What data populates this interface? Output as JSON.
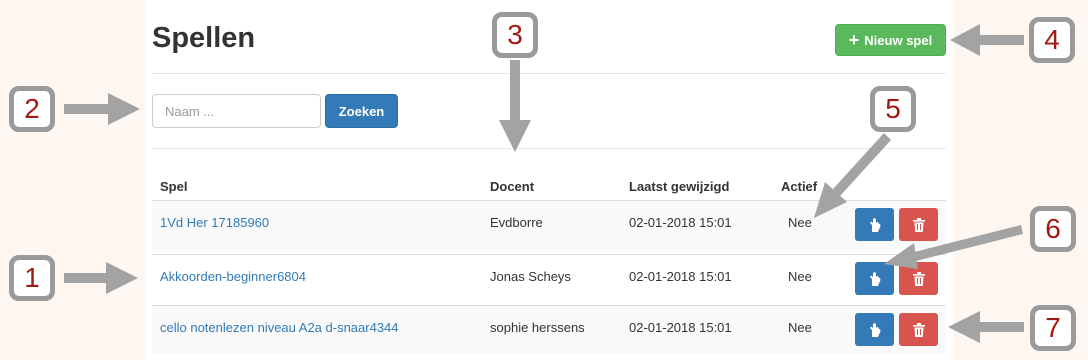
{
  "page": {
    "title": "Spellen"
  },
  "toolbar": {
    "new_game_label": "Nieuw spel",
    "plus_icon": "plus-icon"
  },
  "search": {
    "placeholder": "Naam ...",
    "button_label": "Zoeken"
  },
  "table": {
    "headers": {
      "game": "Spel",
      "teacher": "Docent",
      "modified": "Laatst gewijzigd",
      "active": "Actief"
    },
    "rows": [
      {
        "game": "1Vd Her 17185960",
        "teacher": "Evdborre",
        "modified": "02-01-2018 15:01",
        "active": "Nee"
      },
      {
        "game": "Akkoorden-beginner6804",
        "teacher": "Jonas Scheys",
        "modified": "02-01-2018 15:01",
        "active": "Nee"
      },
      {
        "game": "cello notenlezen niveau A2a d-snaar4344",
        "teacher": "sophie herssens",
        "modified": "02-01-2018 15:01",
        "active": "Nee"
      }
    ],
    "row_action_icons": [
      "hand-icon",
      "trash-icon"
    ]
  },
  "callouts": [
    "1",
    "2",
    "3",
    "4",
    "5",
    "6",
    "7"
  ],
  "colors": {
    "primary": "#337ab7",
    "success": "#5cb85c",
    "danger": "#d9534f",
    "callout_border": "#9a9a9a",
    "callout_number": "#a01b14"
  }
}
